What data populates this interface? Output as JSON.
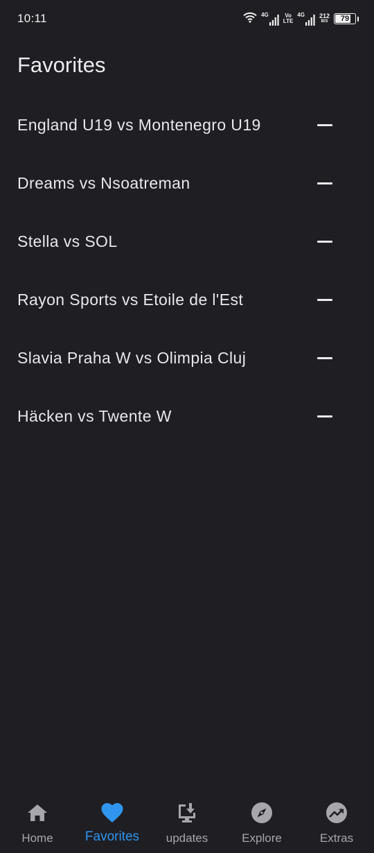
{
  "status_bar": {
    "time": "10:11",
    "net1": "4G",
    "volte_top": "Vo",
    "volte_bottom": "LTE",
    "net2": "4G",
    "speed_value": "212",
    "speed_unit": "B/S",
    "battery": "79",
    "battery_level": 0.79
  },
  "page": {
    "title": "Favorites"
  },
  "favorites": [
    {
      "label": "England U19 vs Montenegro U19"
    },
    {
      "label": "Dreams vs Nsoatreman"
    },
    {
      "label": "Stella vs SOL"
    },
    {
      "label": "Rayon Sports vs Etoile de l'Est"
    },
    {
      "label": "Slavia Praha W vs Olimpia Cluj"
    },
    {
      "label": "Häcken vs Twente W"
    }
  ],
  "bottom_nav": {
    "items": [
      {
        "label": "Home",
        "icon": "home-icon"
      },
      {
        "label": "Favorites",
        "icon": "heart-icon"
      },
      {
        "label": "updates",
        "icon": "download-icon"
      },
      {
        "label": "Explore",
        "icon": "compass-icon"
      },
      {
        "label": "Extras",
        "icon": "trending-icon"
      }
    ],
    "active_index": 1
  },
  "colors": {
    "background": "#1f1e23",
    "text": "#e8e8eb",
    "nav_inactive": "#a7a7ab",
    "accent": "#2f95ee"
  }
}
